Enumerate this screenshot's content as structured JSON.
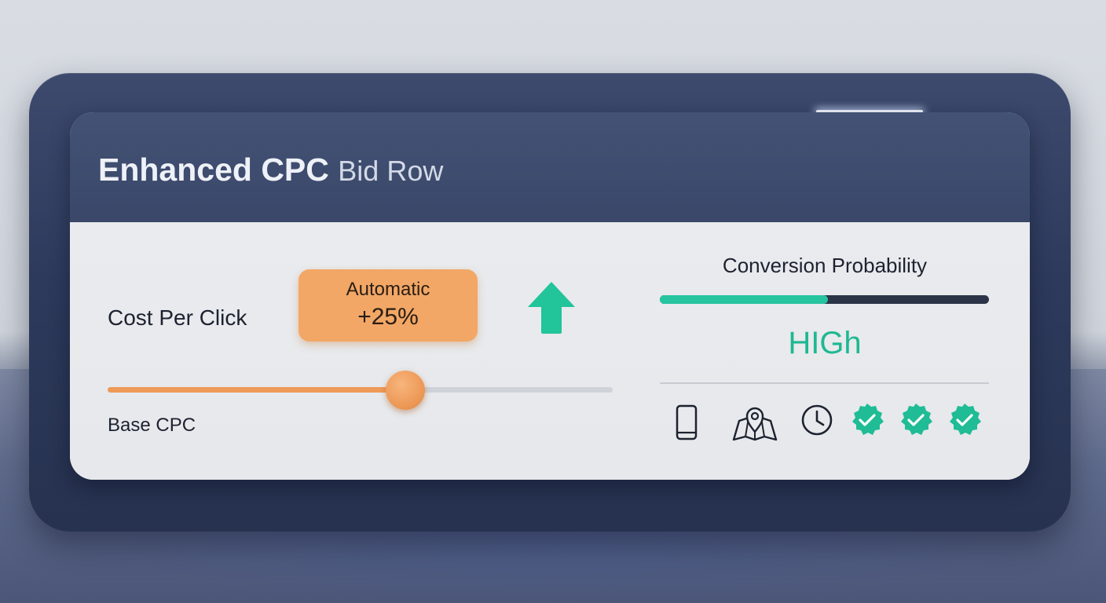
{
  "card": {
    "title_strong": "Enhanced CPC",
    "title_light": "Bid Row"
  },
  "bid": {
    "cost_label": "Cost Per Click",
    "auto_label": "Automatic",
    "auto_value": "+25%",
    "adjustment_direction_icon": "arrow-up-icon",
    "base_label": "Base CPC",
    "slider_level": 0.59
  },
  "conversion": {
    "title": "Conversion Probability",
    "level_text": "HIGh",
    "bar_fill": 0.51
  },
  "signals": [
    {
      "icon": "mobile-device-icon"
    },
    {
      "icon": "location-map-icon"
    },
    {
      "icon": "clock-icon"
    },
    {
      "icon": "check-badge-icon"
    },
    {
      "icon": "check-badge-icon"
    },
    {
      "icon": "check-badge-icon"
    }
  ],
  "colors": {
    "accent_orange": "#ee9a58",
    "accent_teal": "#27c4a0",
    "header_navy": "#3e4b6e",
    "header_underline": "#4f7de6",
    "high_text": "#1eb892"
  }
}
